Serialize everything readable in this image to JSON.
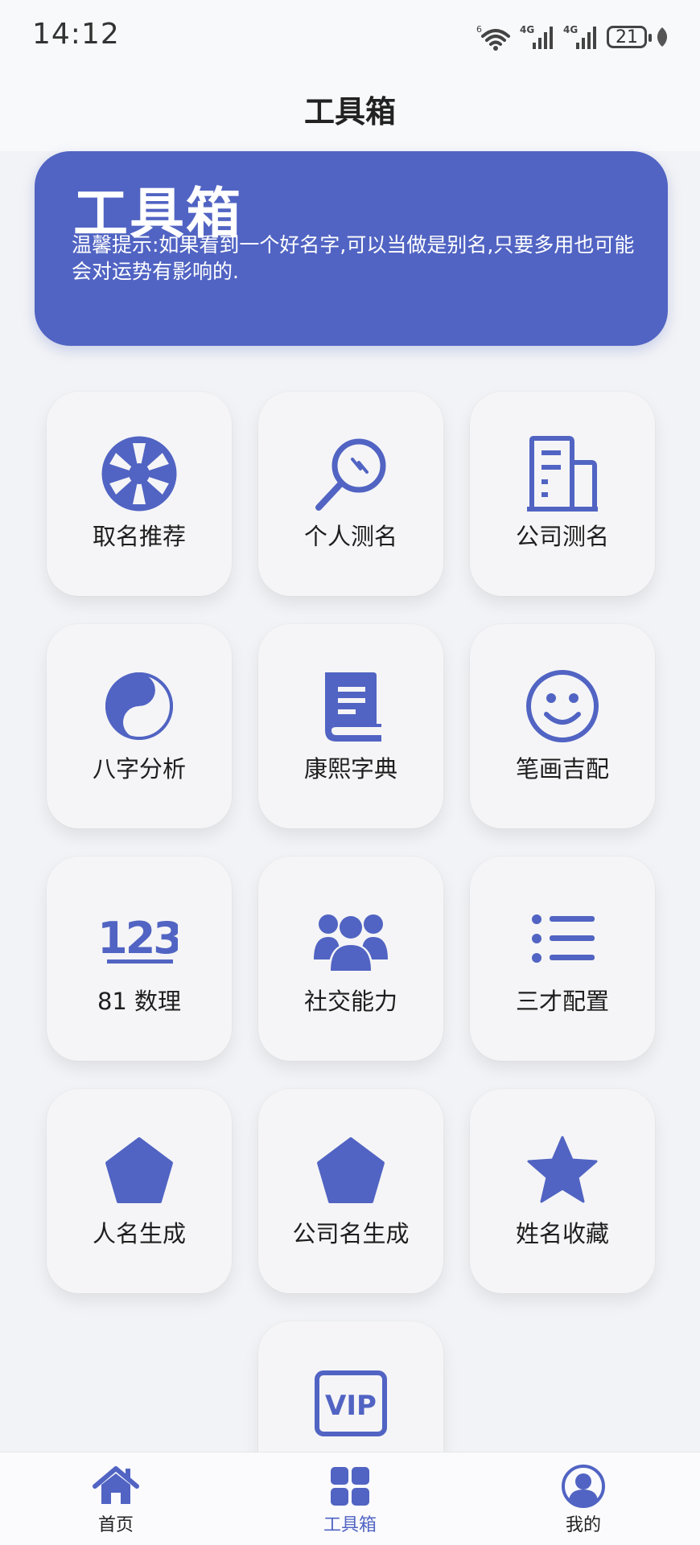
{
  "status_bar": {
    "time": "14:12",
    "wifi_badge": "6",
    "signal1_badge": "4G",
    "signal2_badge": "4G",
    "battery": "21"
  },
  "nav": {
    "title": "工具箱"
  },
  "banner": {
    "title": "工具箱",
    "tip": "温馨提示:如果看到一个好名字,可以当做是别名,只要多用也可能会对运势有影响的."
  },
  "tools": [
    {
      "label": "取名推荐",
      "icon": "wheel-icon"
    },
    {
      "label": "个人测名",
      "icon": "magnifier-icon"
    },
    {
      "label": "公司测名",
      "icon": "building-icon"
    },
    {
      "label": "八字分析",
      "icon": "yin-yang-icon"
    },
    {
      "label": "康熙字典",
      "icon": "book-icon"
    },
    {
      "label": "笔画吉配",
      "icon": "smile-icon"
    },
    {
      "label": "81 数理",
      "icon": "numbers-123-icon"
    },
    {
      "label": "社交能力",
      "icon": "group-icon"
    },
    {
      "label": "三才配置",
      "icon": "list-icon"
    },
    {
      "label": "人名生成",
      "icon": "pentagon-icon"
    },
    {
      "label": "公司名生成",
      "icon": "pentagon-icon"
    },
    {
      "label": "姓名收藏",
      "icon": "star-icon"
    },
    {
      "label": "",
      "icon": "vip-icon",
      "vip_text": "VIP"
    }
  ],
  "tabbar": {
    "items": [
      {
        "label": "首页",
        "icon": "home-icon",
        "active": false
      },
      {
        "label": "工具箱",
        "icon": "grid-icon",
        "active": true
      },
      {
        "label": "我的",
        "icon": "profile-icon",
        "active": false
      }
    ]
  },
  "colors": {
    "accent": "#5164c3",
    "background": "#f2f3f6",
    "tile": "#f5f5f7"
  }
}
